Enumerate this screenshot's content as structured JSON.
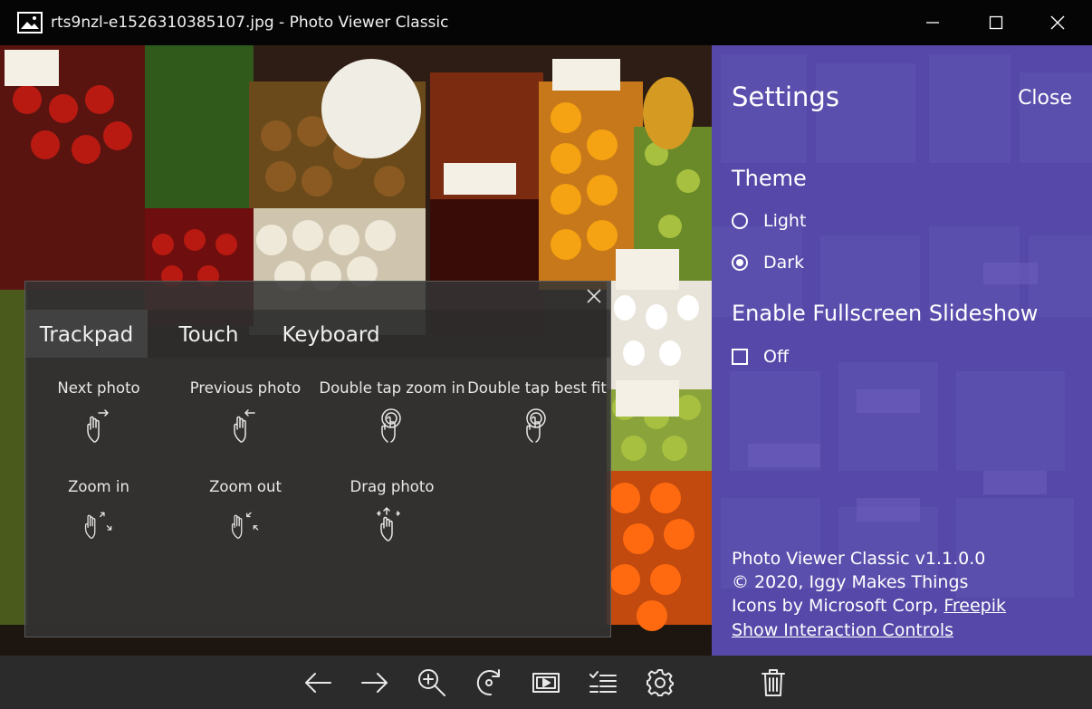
{
  "window": {
    "title": "rts9nzl-e1526310385107.jpg - Photo Viewer Classic"
  },
  "help": {
    "tabs": [
      {
        "label": "Trackpad",
        "active": true
      },
      {
        "label": "Touch",
        "active": false
      },
      {
        "label": "Keyboard",
        "active": false
      }
    ],
    "gestures": [
      {
        "label": "Next photo",
        "icon": "swipe-right-icon"
      },
      {
        "label": "Previous photo",
        "icon": "swipe-left-icon"
      },
      {
        "label": "Double tap zoom in",
        "icon": "double-tap-icon"
      },
      {
        "label": "Double tap best fit",
        "icon": "double-tap-icon"
      },
      {
        "label": "Zoom in",
        "icon": "pinch-out-icon"
      },
      {
        "label": "Zoom out",
        "icon": "pinch-in-icon"
      },
      {
        "label": "Drag photo",
        "icon": "drag-icon"
      }
    ]
  },
  "settings": {
    "title": "Settings",
    "close_label": "Close",
    "theme_heading": "Theme",
    "theme_options": [
      {
        "label": "Light",
        "checked": false
      },
      {
        "label": "Dark",
        "checked": true
      }
    ],
    "slideshow_heading": "Enable Fullscreen Slideshow",
    "slideshow_label": "Off",
    "slideshow_checked": false,
    "version": "Photo Viewer Classic v1.1.0.0",
    "copyright": "© 2020,  Iggy Makes Things",
    "icons_credit_prefix": "Icons by Microsoft Corp, ",
    "icons_credit_link": "Freepik",
    "interaction_link": "Show Interaction Controls"
  },
  "toolbar": {
    "buttons": [
      "previous-icon",
      "next-icon",
      "zoom-in-icon",
      "rotate-icon",
      "slideshow-icon",
      "settings-list-icon",
      "gear-icon",
      "delete-icon"
    ]
  },
  "colors": {
    "settings_bg": "#5548a8",
    "toolbar_bg": "#2b2b2b",
    "titlebar_bg": "#050505"
  }
}
